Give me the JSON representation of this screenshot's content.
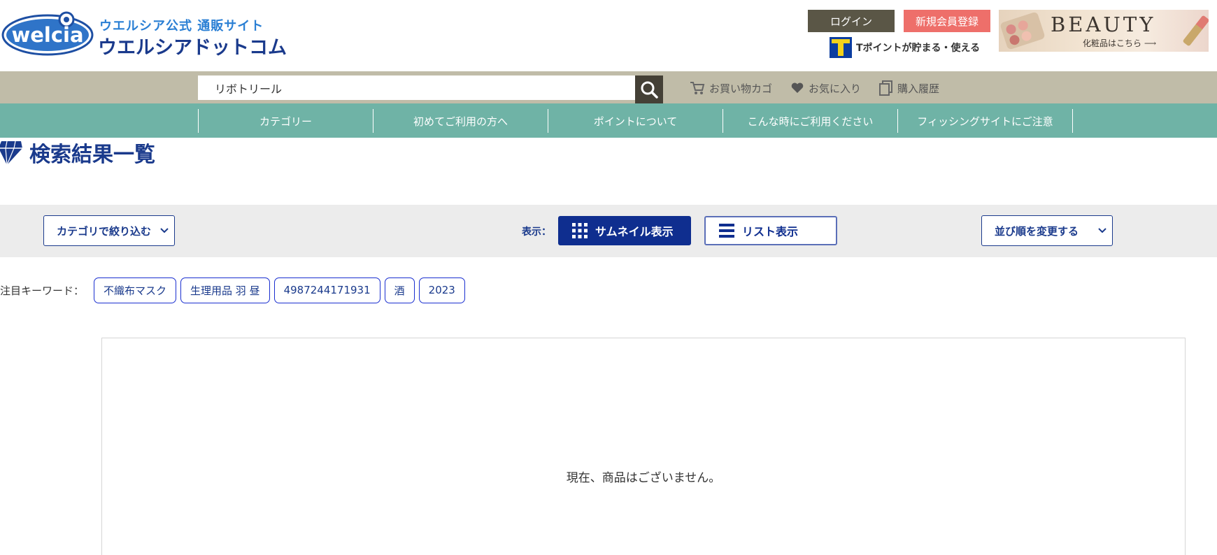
{
  "header": {
    "logo_mark": "welcia",
    "logo_tagline": "ウエルシア公式 通販サイト",
    "logo_name": "ウエルシアドットコム",
    "login_label": "ログイン",
    "register_label": "新規会員登録",
    "tpoint_text": "Tポイントが貯まる・使える",
    "banner": {
      "title": "BEAUTY",
      "subtitle": "化粧品はこちら ⟶"
    }
  },
  "search": {
    "value": "リボトリール"
  },
  "utility_links": [
    {
      "label": "お買い物カゴ",
      "icon": "cart-icon"
    },
    {
      "label": "お気に入り",
      "icon": "heart-icon"
    },
    {
      "label": "購入履歴",
      "icon": "history-icon"
    }
  ],
  "nav": {
    "items": [
      "カテゴリー",
      "初めてご利用の方へ",
      "ポイントについて",
      "こんな時にご利用ください",
      "フィッシングサイトにご注意"
    ]
  },
  "page": {
    "title": "検索結果一覧"
  },
  "controls": {
    "category_filter_label": "カテゴリで絞り込む",
    "view_label": "表示：",
    "thumbnail_label": "サムネイル表示",
    "list_label": "リスト表示",
    "sort_label": "並び順を変更する"
  },
  "keywords": {
    "label": "注目キーワード：",
    "tags": [
      "不織布マスク",
      "生理用品 羽 昼",
      "4987244171931",
      "酒",
      "2023"
    ]
  },
  "results": {
    "empty_message": "現在、商品はございません。"
  },
  "colors": {
    "brand_navy": "#1a3a8c",
    "nav_teal": "#6fb3a6",
    "search_bar": "#c0bca8",
    "login_bg": "#5a5646",
    "register_bg": "#ee6f6a",
    "active_view": "#0f2e8f"
  }
}
